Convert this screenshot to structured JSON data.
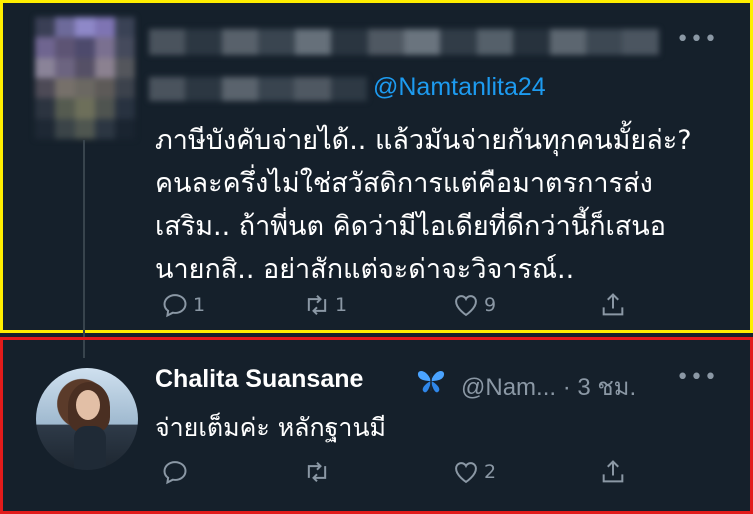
{
  "tweet1": {
    "handle": "@Namtanlita24",
    "text": "ภาษีบังคับจ่ายได้.. แล้วมันจ่ายกันทุกคนมั้ยล่ะ?\nคนละครึ่งไม่ใช่สวัสดิการแต่คือมาตรการส่ง\nเสริม.. ถ้าพี่นต คิดว่ามีไอเดียที่ดีกว่านี้ก็เสนอ\nนายกสิ.. อย่าสักแต่จะด่าจะวิจารณ์..",
    "more": "•••",
    "reply_count": "1",
    "retweet_count": "1",
    "like_count": "9",
    "highlight_color": "#ffef00"
  },
  "tweet2": {
    "name": "Chalita Suansane",
    "badge": "🦋",
    "handle_time": "@Nam... · 3 ชม.",
    "text": "จ่ายเต็มค่ะ หลักฐานมี",
    "more": "•••",
    "reply_count": "",
    "retweet_count": "",
    "like_count": "2",
    "highlight_color": "#e21b1b"
  },
  "icons": {
    "reply": "reply-icon",
    "retweet": "retweet-icon",
    "like": "heart-icon",
    "share": "share-icon"
  },
  "colors": {
    "background": "#15202b",
    "link": "#1d9bf0",
    "muted": "#8b98a5"
  }
}
